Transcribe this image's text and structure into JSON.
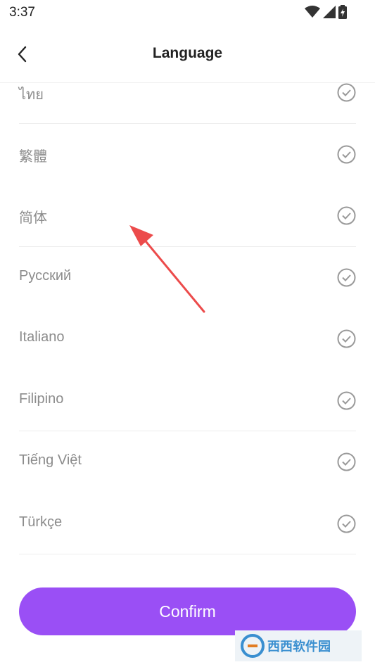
{
  "status": {
    "time": "3:37"
  },
  "header": {
    "title": "Language",
    "back_icon": "chevron-left-icon"
  },
  "languages": [
    {
      "label": "ไทย"
    },
    {
      "label": "繁體"
    },
    {
      "label": "简体"
    },
    {
      "label": "Русский"
    },
    {
      "label": "Italiano"
    },
    {
      "label": "Filipino"
    },
    {
      "label": "Tiếng Việt"
    },
    {
      "label": "Türkçe"
    }
  ],
  "confirm_label": "Confirm",
  "colors": {
    "accent": "#9a4ff5",
    "check": "#9a9a9a",
    "annotation_arrow": "#ec4b4b"
  },
  "watermark": {
    "text": "西西软件园"
  }
}
